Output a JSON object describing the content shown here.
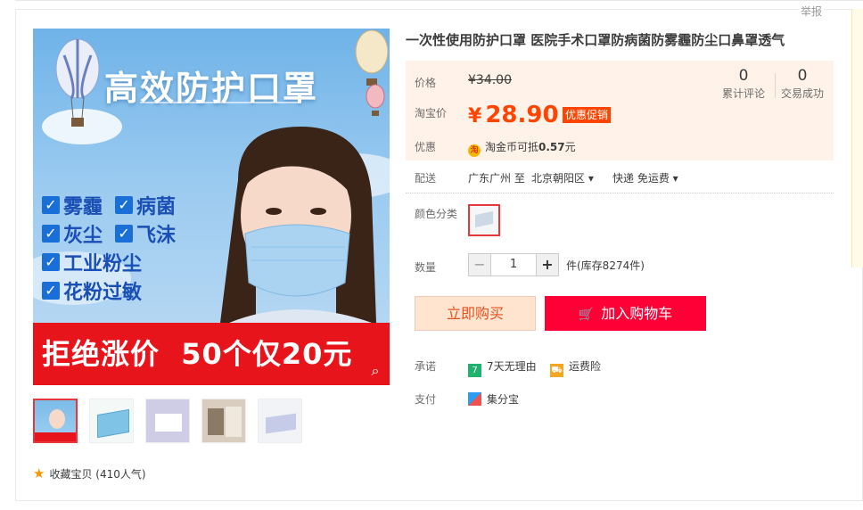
{
  "report_link": "举报",
  "gallery": {
    "hero_title": "高效防护口罩",
    "features": [
      [
        "雾霾",
        "病菌"
      ],
      [
        "灰尘",
        "飞沫"
      ],
      [
        "工业粉尘"
      ],
      [
        "花粉过敏"
      ]
    ],
    "banner": "拒绝涨价  50个仅20元",
    "thumbnails": 5,
    "favorite_label": "收藏宝贝 (410人气)"
  },
  "product": {
    "title": "一次性使用防护口罩 医院手术口罩防病菌防雾霾防尘口鼻罩透气",
    "price_label": "价格",
    "original_price": "¥34.00",
    "promo_label": "淘宝价",
    "promo_currency": "¥",
    "promo_price": "28.90",
    "promo_tag": "优惠促销",
    "stats": [
      {
        "value": "0",
        "label": "累计评论"
      },
      {
        "value": "0",
        "label": "交易成功"
      }
    ],
    "discount_label": "优惠",
    "discount_text": "淘金币可抵",
    "discount_value": "0.57",
    "discount_unit": "元",
    "delivery_label": "配送",
    "delivery_from": "广东广州 至",
    "delivery_to": "北京朝阳区",
    "delivery_method": "快递 免运费",
    "color_label": "颜色分类",
    "quantity_label": "数量",
    "quantity": "1",
    "stock_text": "件(库存8274件)",
    "buy_now": "立即购买",
    "add_to_cart": "加入购物车",
    "promise_label": "承诺",
    "promise_items": [
      "7天无理由",
      "运费险"
    ],
    "pay_label": "支付",
    "pay_method": "集分宝"
  }
}
